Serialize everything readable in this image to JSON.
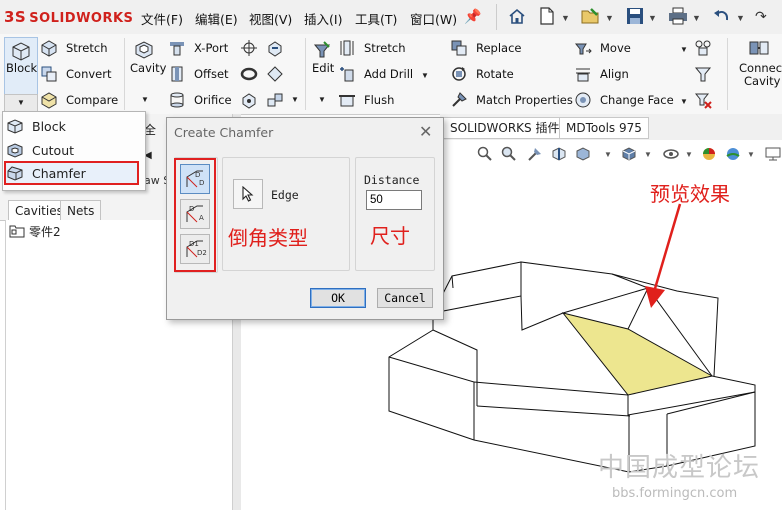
{
  "app": {
    "brand": "SOLIDWORKS",
    "brand_prefix": "3S"
  },
  "menu": {
    "items": [
      "文件(F)",
      "编辑(E)",
      "视图(V)",
      "插入(I)",
      "工具(T)",
      "窗口(W)"
    ]
  },
  "quick_access": [
    "home-icon",
    "new-document-icon",
    "open-icon",
    "save-icon",
    "print-icon",
    "undo-icon"
  ],
  "ribbon": {
    "block_label": "Block",
    "cavity_label": "Cavity",
    "col1": [
      "Stretch",
      "Convert",
      "Compare"
    ],
    "col2": [
      "X-Port",
      "Offset",
      "Orifice"
    ],
    "edit_label": "Edit",
    "col3": [
      "Stretch",
      "Add Drill",
      "Flush"
    ],
    "col4": [
      "Replace",
      "Rotate",
      "Match Properties"
    ],
    "col5": [
      "Move",
      "Align",
      "Change Face"
    ],
    "connect_cavity": [
      "Connect",
      "Cavity"
    ]
  },
  "dropdown": {
    "items": [
      "Block",
      "Cutout",
      "Chamfer"
    ],
    "selected": "Chamfer"
  },
  "left_panel": {
    "tabs": [
      "Cavities",
      "Nets"
    ],
    "tree_root": "零件2",
    "partial_tab": "aw S"
  },
  "viewport": {
    "tabs": [
      "SOLIDWORKS 插件",
      "MDTools 975"
    ],
    "preview_fill": "#ede68f"
  },
  "dialog": {
    "title": "Create Chamfer",
    "type_options": [
      {
        "top": "D",
        "bottom": "D"
      },
      {
        "top": "D",
        "bottom": "A"
      },
      {
        "top": "D1",
        "bottom": "D2"
      }
    ],
    "edge_label": "Edge",
    "distance_label": "Distance",
    "distance_value": "50",
    "ok_label": "OK",
    "cancel_label": "Cancel"
  },
  "annotations": {
    "chamfer_type": "倒角类型",
    "dimension": "尺寸",
    "preview": "预览效果",
    "color": "#e0201c"
  },
  "watermark": {
    "title": "中国成型论坛",
    "url": "bbs.formingcn.com"
  }
}
